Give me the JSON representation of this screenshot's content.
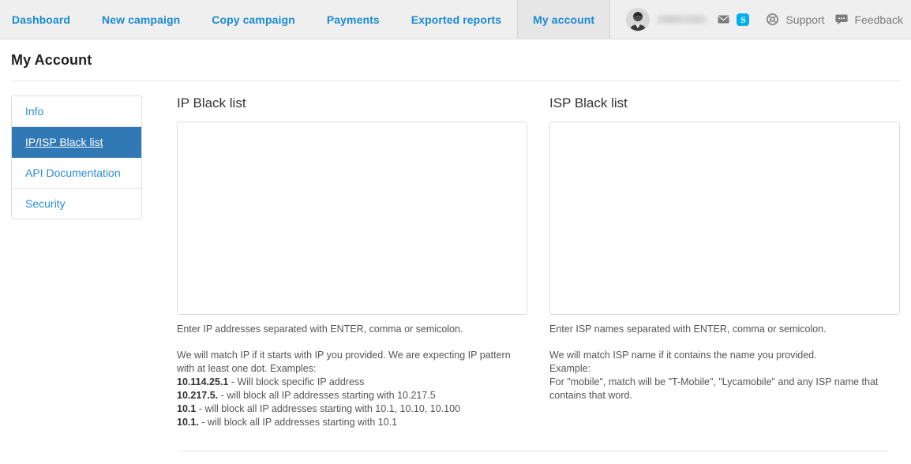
{
  "topnav": {
    "tabs": [
      {
        "label": "Dashboard",
        "active": false
      },
      {
        "label": "New campaign",
        "active": false
      },
      {
        "label": "Copy campaign",
        "active": false
      },
      {
        "label": "Payments",
        "active": false
      },
      {
        "label": "Exported reports",
        "active": false
      },
      {
        "label": "My account",
        "active": true
      }
    ],
    "account": {
      "avatar_icon": "user-avatar-photo",
      "username": "",
      "mail_icon": "envelope-icon",
      "skype_icon": "skype-icon",
      "skype_letter": "S"
    },
    "support": {
      "icon": "lifebuoy-icon",
      "label": "Support"
    },
    "feedback": {
      "icon": "speech-bubble-icon",
      "label": "Feedback"
    }
  },
  "page": {
    "title": "My Account"
  },
  "sidebar": {
    "items": [
      {
        "label": "Info",
        "active": false
      },
      {
        "label": "IP/ISP Black list",
        "active": true
      },
      {
        "label": "API Documentation",
        "active": false
      },
      {
        "label": "Security",
        "active": false
      }
    ]
  },
  "ip_column": {
    "title": "IP Black list",
    "textarea_value": "",
    "textarea_placeholder": "",
    "hint_main": "Enter IP addresses separated with ENTER, comma or semicolon.",
    "hint_intro": "We will match IP if it starts with IP you provided. We are expecting IP pattern with at least one dot. Examples:",
    "examples": [
      {
        "pattern": "10.114.25.1",
        "desc": " - Will block specific IP address"
      },
      {
        "pattern": "10.217.5.",
        "desc": " - will block all IP addresses starting with 10.217.5"
      },
      {
        "pattern": "10.1",
        "desc": " - will block all IP addresses starting with 10.1, 10.10, 10.100"
      },
      {
        "pattern": "10.1.",
        "desc": " - will block all IP addresses starting with 10.1"
      }
    ]
  },
  "isp_column": {
    "title": "ISP Black list",
    "textarea_value": "",
    "textarea_placeholder": "",
    "hint_main": "Enter ISP names separated with ENTER, comma or semicolon.",
    "hint_line1": "We will match ISP name if it contains the name you provided.",
    "hint_line2": "Example:",
    "hint_line3": "For \"mobile\", match will be \"T-Mobile\", \"Lycamobile\" and any ISP name that contains that word."
  },
  "colors": {
    "link_blue": "#1a8bd4",
    "active_sidebar_blue": "#3179b5",
    "topbar_bg": "#efefef",
    "skype_blue": "#00aff0"
  }
}
